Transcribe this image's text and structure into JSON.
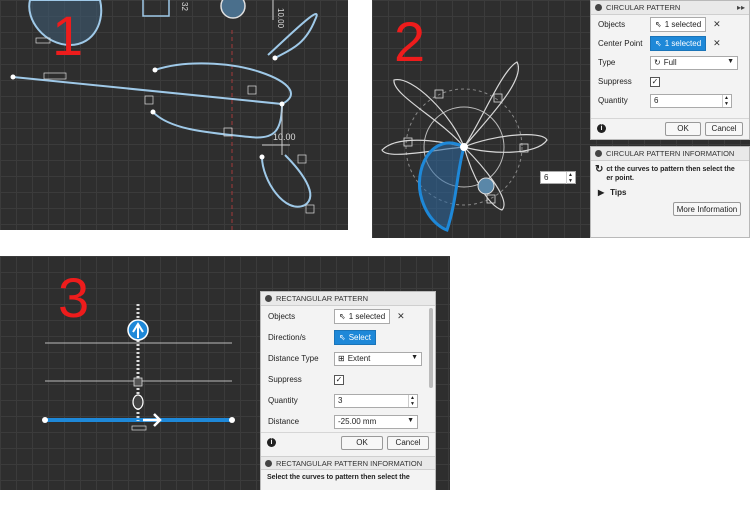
{
  "steps": [
    "1",
    "2",
    "3"
  ],
  "pane1": {
    "dimension_upper": "10.00",
    "dimension_lower": "10.00",
    "dimension_top": "32"
  },
  "circular": {
    "title": "CIRCULAR PATTERN",
    "objects_label": "Objects",
    "objects_value": "1 selected",
    "center_label": "Center Point",
    "center_value": "1 selected",
    "type_label": "Type",
    "type_value": "Full",
    "suppress_label": "Suppress",
    "quantity_label": "Quantity",
    "quantity_value": "6",
    "ok": "OK",
    "cancel": "Cancel",
    "info_title": "CIRCULAR PATTERN INFORMATION",
    "info_text_1": "ct the curves to pattern then select the",
    "info_text_2": "er point.",
    "tips": "Tips",
    "more_info": "More Information",
    "canvas_quantity": "6"
  },
  "rectangular": {
    "title": "RECTANGULAR PATTERN",
    "objects_label": "Objects",
    "objects_value": "1 selected",
    "direction_label": "Direction/s",
    "direction_value": "Select",
    "distance_type_label": "Distance Type",
    "distance_type_value": "Extent",
    "suppress_label": "Suppress",
    "quantity_label": "Quantity",
    "quantity_value": "3",
    "distance_label": "Distance",
    "distance_value": "-25.00 mm",
    "ok": "OK",
    "cancel": "Cancel",
    "info_title": "RECTANGULAR PATTERN INFORMATION",
    "info_text": "Select the curves to pattern then select the"
  },
  "colors": {
    "sketch_line": "#9fc9e8",
    "selected": "#1e88d8",
    "red_number": "#ee1c1c",
    "canvas_bg": "#2e2e2e"
  }
}
